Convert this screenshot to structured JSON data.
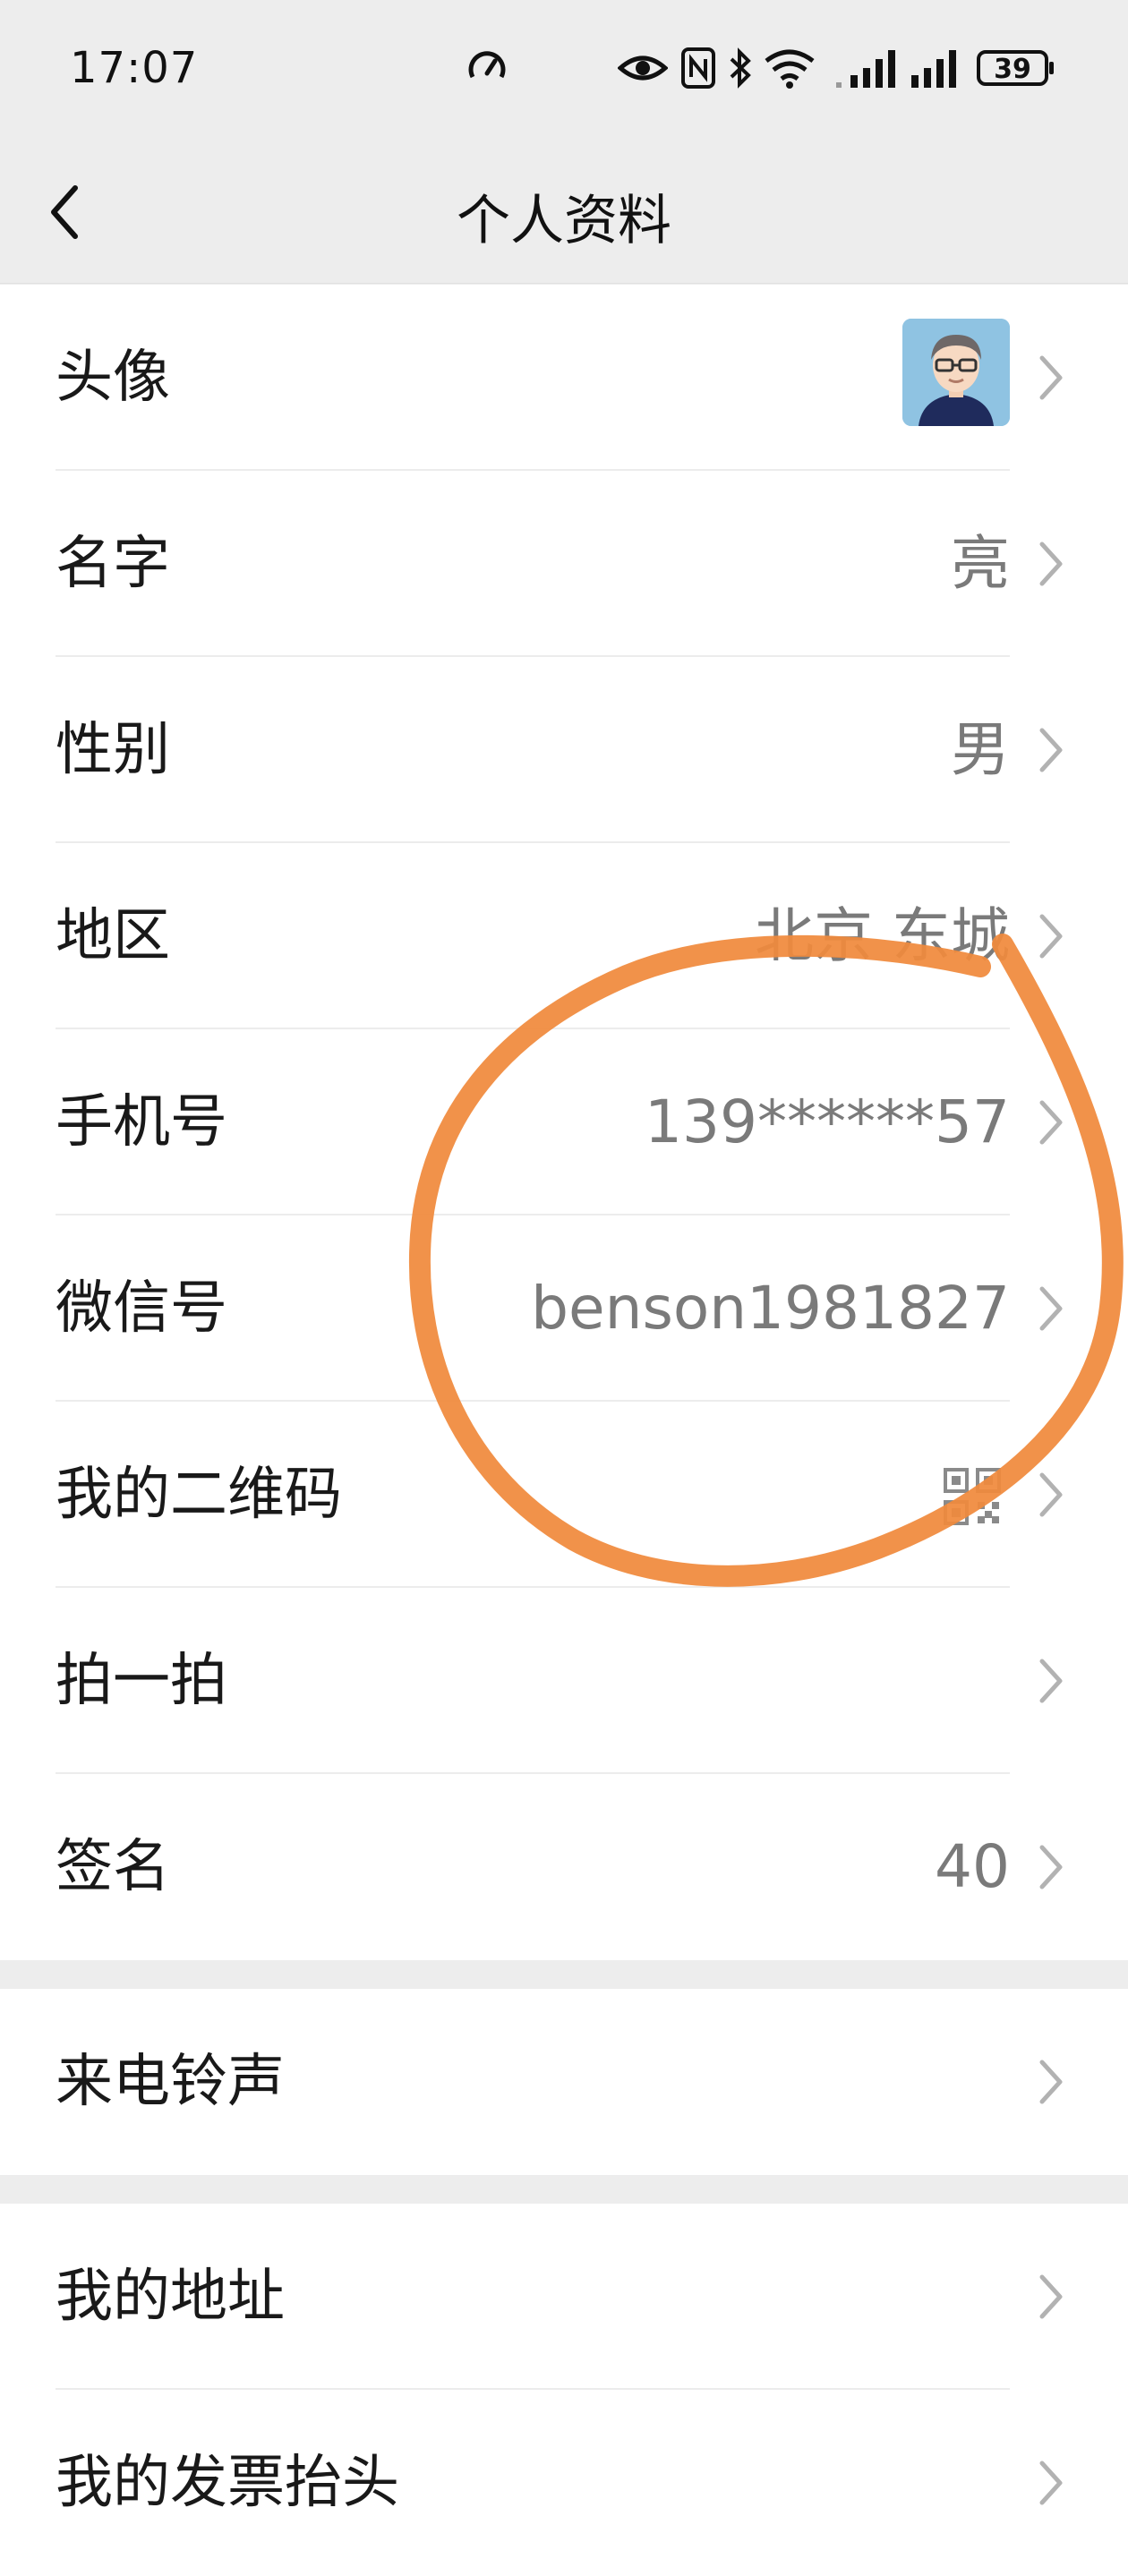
{
  "status_bar": {
    "time": "17:07",
    "battery_level": "39",
    "icons": [
      "speedometer-icon",
      "eye-icon",
      "nfc-icon",
      "bluetooth-icon",
      "wifi-icon",
      "signal-icon",
      "signal-icon",
      "battery-icon"
    ]
  },
  "header": {
    "title": "个人资料",
    "back_icon": "chevron-left-icon"
  },
  "profile": {
    "avatar_label": "头像",
    "name_label": "名字",
    "name_value": "亮",
    "gender_label": "性别",
    "gender_value": "男",
    "region_label": "地区",
    "region_value": "北京 东城",
    "phone_label": "手机号",
    "phone_value": "139******57",
    "wechat_id_label": "微信号",
    "wechat_id_value": "benson1981827",
    "qr_label": "我的二维码",
    "qr_icon": "qr-code-icon",
    "pat_label": "拍一拍",
    "signature_label": "签名",
    "signature_value": "40"
  },
  "ringtone": {
    "label": "来电铃声"
  },
  "addresses": {
    "my_address_label": "我的地址",
    "invoice_label": "我的发票抬头"
  },
  "colors": {
    "background": "#ededed",
    "card": "#ffffff",
    "text": "#191919",
    "secondary_text": "#7a7a7a",
    "chevron": "#b2b2b2",
    "annotation_circle": "#f08a3c"
  }
}
